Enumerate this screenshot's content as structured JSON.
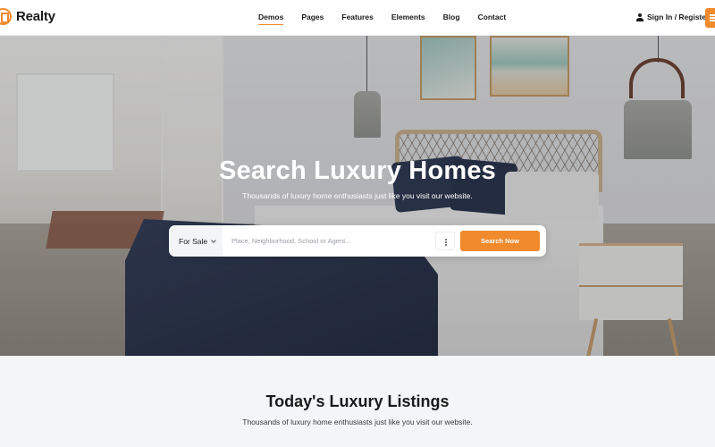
{
  "brand": {
    "name": "Realty",
    "accent_color": "#f08a2c"
  },
  "nav": {
    "items": [
      {
        "label": "Demos",
        "active": true
      },
      {
        "label": "Pages",
        "active": false
      },
      {
        "label": "Features",
        "active": false
      },
      {
        "label": "Elements",
        "active": false
      },
      {
        "label": "Blog",
        "active": false
      },
      {
        "label": "Contact",
        "active": false
      }
    ],
    "signin_label": "Sign In / Register",
    "signin_icon": "user-icon",
    "menu_icon": "hamburger-icon"
  },
  "hero": {
    "title": "Search Luxury Homes",
    "subtitle": "Thousands of luxury home enthusiasts just like you visit our website.",
    "background_description": "Bright bedroom interior with navy blanket, pendant lamps and beach art"
  },
  "search": {
    "type_selected": "For Sale",
    "input_value": "",
    "input_placeholder": "Place, Neighborhood, School or Agent...",
    "more_icon": "vertical-dots-icon",
    "submit_label": "Search Now"
  },
  "listings": {
    "title": "Today's Luxury Listings",
    "subtitle": "Thousands of luxury home enthusiasts just like you visit our website."
  }
}
